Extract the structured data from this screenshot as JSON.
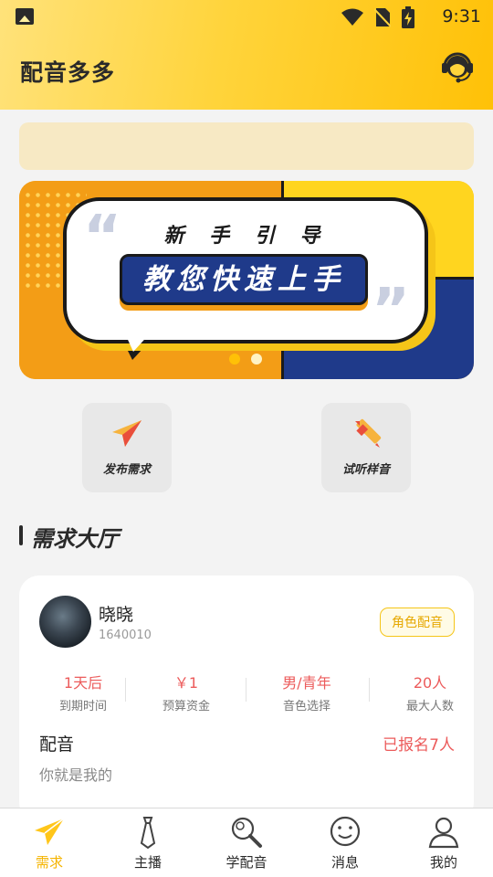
{
  "status_bar": {
    "time": "9:31"
  },
  "header": {
    "title": "配音多多",
    "service_icon": "headset-icon"
  },
  "banner": {
    "line1": "新 手 引 导",
    "line2": "教您快速上手",
    "quote_open": "“",
    "quote_close": "”",
    "colors": {
      "orange": "#f39d16",
      "yellow": "#ffd51f",
      "navy": "#1f3a8a"
    }
  },
  "quick_actions": [
    {
      "label": "发布需求",
      "icon": "paper-plane-icon"
    },
    {
      "label": "试听样音",
      "icon": "pencil-icon"
    }
  ],
  "section": {
    "title": "需求大厅"
  },
  "demand_card": {
    "user_name": "晓晓",
    "user_id": "1640010",
    "tag": "角色配音",
    "stats": [
      {
        "value": "1天后",
        "label": "到期时间"
      },
      {
        "value": "￥1",
        "label": "预算资金"
      },
      {
        "value": "男/青年",
        "label": "音色选择"
      },
      {
        "value": "20人",
        "label": "最大人数"
      }
    ],
    "title": "配音",
    "signup": "已报名7人",
    "description": "你就是我的"
  },
  "tabbar": {
    "active_color": "#f5b400",
    "items": [
      {
        "label": "需求",
        "icon": "paper-plane-icon",
        "active": true
      },
      {
        "label": "主播",
        "icon": "tie-icon",
        "active": false
      },
      {
        "label": "学配音",
        "icon": "magnifier-icon",
        "active": false
      },
      {
        "label": "消息",
        "icon": "smile-chat-icon",
        "active": false
      },
      {
        "label": "我的",
        "icon": "user-icon",
        "active": false
      }
    ]
  }
}
